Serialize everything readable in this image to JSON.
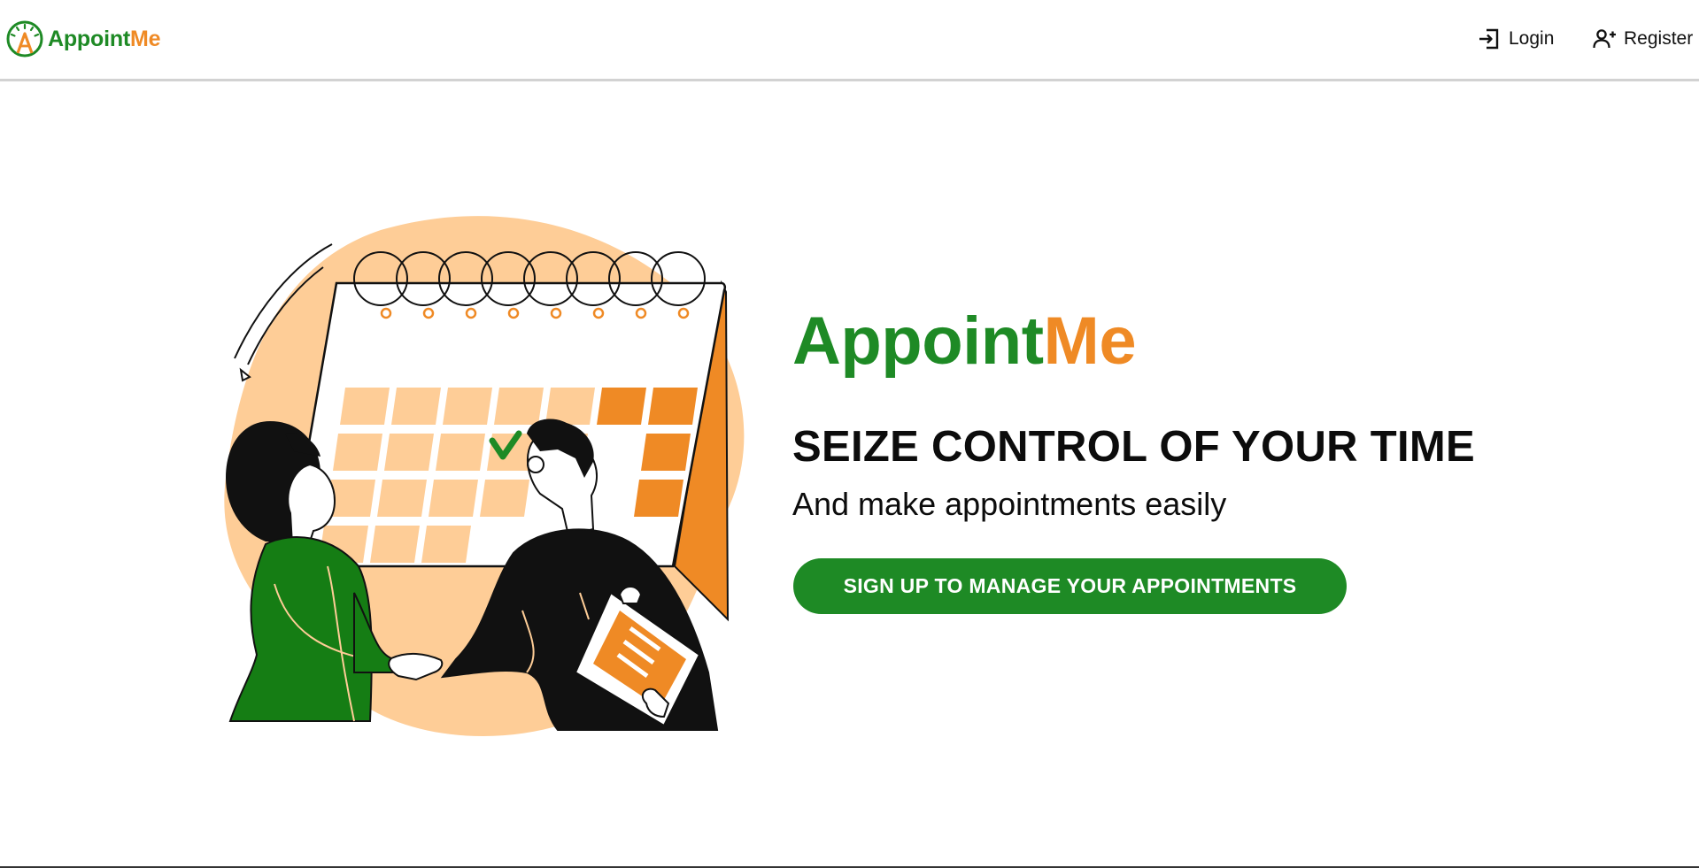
{
  "brand": {
    "name_part1": "Appoint",
    "name_part2": "Me",
    "logo_icon": "clock-a-logo-icon",
    "color_green": "#1e8a25",
    "color_orange": "#ef8a25"
  },
  "nav": {
    "login": {
      "label": "Login",
      "icon": "login-icon"
    },
    "register": {
      "label": "Register",
      "icon": "add-user-icon"
    }
  },
  "hero": {
    "title_part1": "Appoint",
    "title_part2": "Me",
    "headline": "SEIZE CONTROL OF YOUR TIME",
    "subheadline": "And make appointments easily",
    "cta_label": "SIGN UP TO MANAGE YOUR APPOINTMENTS",
    "illustration": "calendar-handshake-illustration"
  }
}
